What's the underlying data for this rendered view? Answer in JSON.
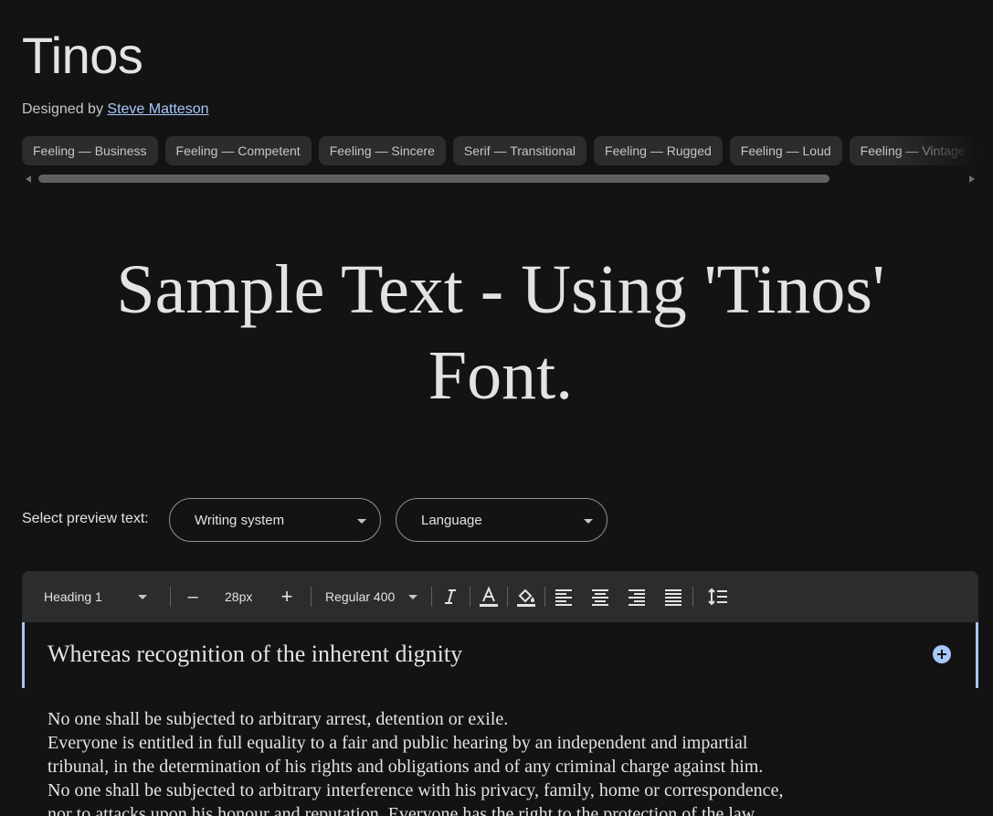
{
  "font": {
    "name": "Tinos",
    "designed_by_label": "Designed by",
    "designer": "Steve Matteson"
  },
  "tags": [
    "Feeling — Business",
    "Feeling — Competent",
    "Feeling — Sincere",
    "Serif — Transitional",
    "Feeling — Rugged",
    "Feeling — Loud",
    "Feeling — Vintage"
  ],
  "sample_text": "Sample Text - Using 'Tinos' Font.",
  "preview": {
    "label": "Select preview text:",
    "writing_system": "Writing system",
    "language": "Language"
  },
  "toolbar": {
    "style": "Heading 1",
    "decrease": "–",
    "size": "28px",
    "increase": "+",
    "weight": "Regular 400",
    "icons": [
      "italic-icon",
      "text-color-icon",
      "highlight-color-icon",
      "align-left-icon",
      "align-center-icon",
      "align-right-icon",
      "align-justify-icon",
      "line-height-icon"
    ]
  },
  "editor": {
    "heading": "Whereas recognition of the inherent dignity",
    "body_lines": [
      "No one shall be subjected to arbitrary arrest, detention or exile.",
      "Everyone is entitled in full equality to a fair and public hearing by an independent and impartial",
      "tribunal, in the determination of his rights and obligations and of any criminal charge against him.",
      "No one shall be subjected to arbitrary interference with his privacy, family, home or correspondence,",
      "nor to attacks upon his honour and reputation. Everyone has the right to the protection of the law"
    ]
  },
  "colors": {
    "background": "#131314",
    "surface": "#2b2c2d",
    "accent": "#a8c7fa",
    "text": "#e3e3e3"
  }
}
